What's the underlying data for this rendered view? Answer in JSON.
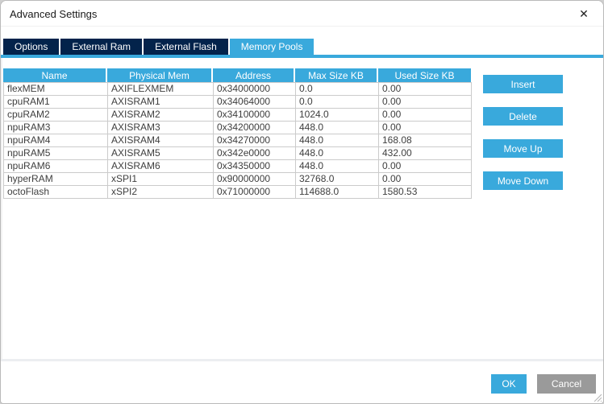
{
  "window": {
    "title": "Advanced Settings",
    "close_glyph": "✕"
  },
  "tabs": [
    {
      "label": "Options",
      "active": false
    },
    {
      "label": "External Ram",
      "active": false
    },
    {
      "label": "External Flash",
      "active": false
    },
    {
      "label": "Memory Pools",
      "active": true
    }
  ],
  "table": {
    "columns": [
      "Name",
      "Physical Mem",
      "Address",
      "Max Size KB",
      "Used Size KB"
    ],
    "rows": [
      [
        "flexMEM",
        "AXIFLEXMEM",
        "0x34000000",
        "0.0",
        "0.00"
      ],
      [
        "cpuRAM1",
        "AXISRAM1",
        "0x34064000",
        "0.0",
        "0.00"
      ],
      [
        "cpuRAM2",
        "AXISRAM2",
        "0x34100000",
        "1024.0",
        "0.00"
      ],
      [
        "npuRAM3",
        "AXISRAM3",
        "0x34200000",
        "448.0",
        "0.00"
      ],
      [
        "npuRAM4",
        "AXISRAM4",
        "0x34270000",
        "448.0",
        "168.08"
      ],
      [
        "npuRAM5",
        "AXISRAM5",
        "0x342e0000",
        "448.0",
        "432.00"
      ],
      [
        "npuRAM6",
        "AXISRAM6",
        "0x34350000",
        "448.0",
        "0.00"
      ],
      [
        "hyperRAM",
        "xSPI1",
        "0x90000000",
        "32768.0",
        "0.00"
      ],
      [
        "octoFlash",
        "xSPI2",
        "0x71000000",
        "114688.0",
        "1580.53"
      ]
    ]
  },
  "actions": {
    "insert": "Insert",
    "delete": "Delete",
    "move_up": "Move Up",
    "move_down": "Move Down"
  },
  "footer": {
    "ok": "OK",
    "cancel": "Cancel"
  },
  "colors": {
    "accent_blue": "#39a9dc",
    "tab_dark_navy": "#03234b",
    "cancel_gray": "#9a9a9a",
    "table_border": "#cbcbcb"
  }
}
